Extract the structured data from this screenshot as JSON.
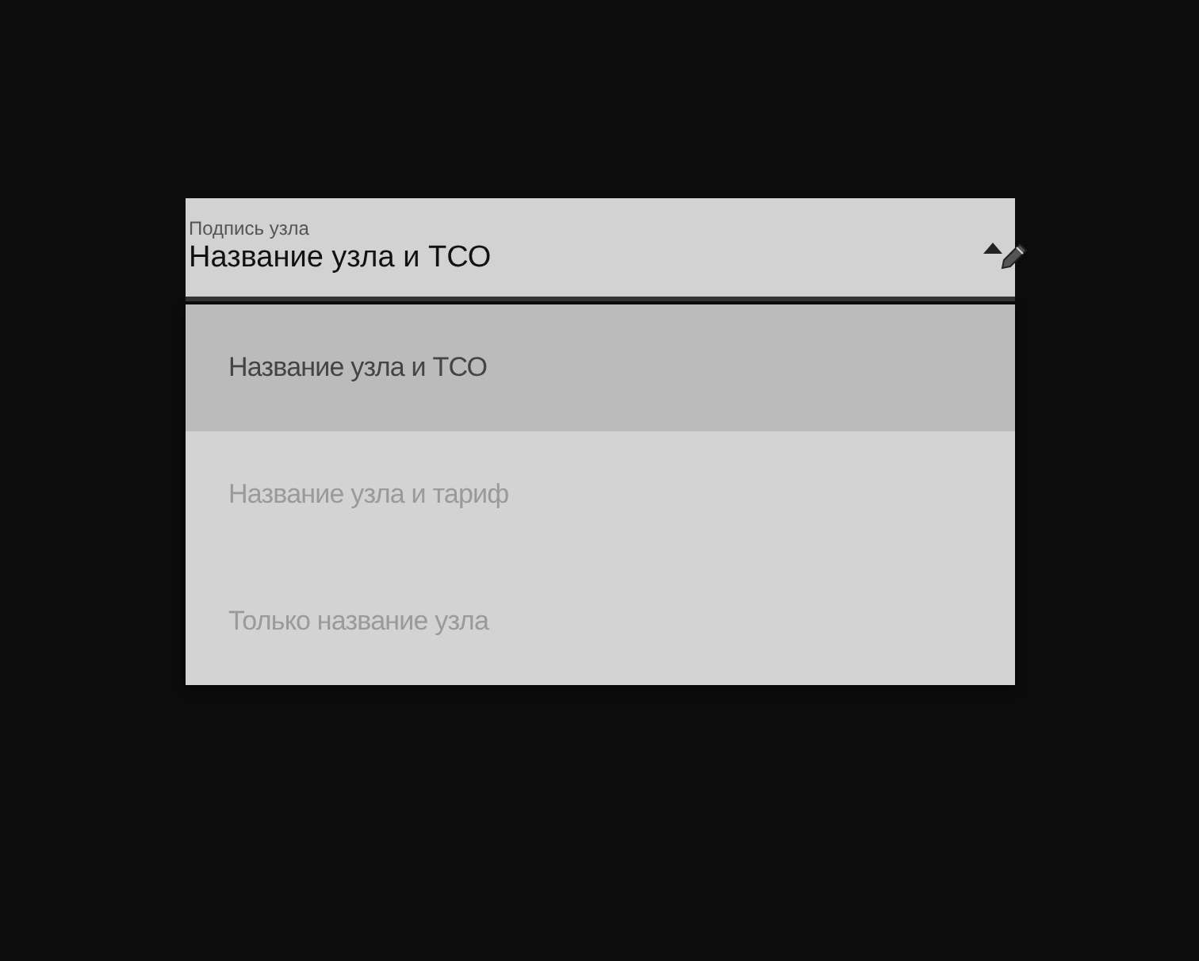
{
  "field": {
    "label": "Подпись узла",
    "value": "Название узла и ТСО",
    "expanded": true
  },
  "options": [
    {
      "label": "Название узла и ТСО",
      "selected": true
    },
    {
      "label": "Название узла и тариф",
      "selected": false
    },
    {
      "label": "Только название узла",
      "selected": false
    }
  ]
}
